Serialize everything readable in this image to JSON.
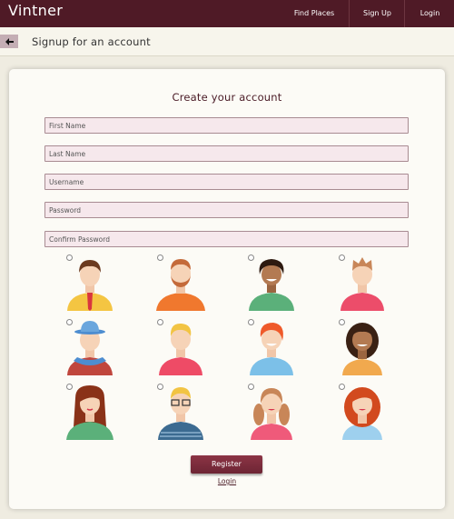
{
  "header": {
    "brand": "Vintner",
    "nav": [
      "Find Places",
      "Sign Up",
      "Login"
    ]
  },
  "subheader": {
    "title": "Signup for an account",
    "back_icon": "arrow-left-icon"
  },
  "form": {
    "title": "Create your account",
    "fields": {
      "first_name": "First Name",
      "last_name": "Last Name",
      "username": "Username",
      "password": "Password",
      "confirm_password": "Confirm Password"
    },
    "avatars": [
      "avatar-man-brown-hair-tie",
      "avatar-man-beard-orange-shirt",
      "avatar-man-curly-hair",
      "avatar-boy-spiky-hair",
      "avatar-man-blue-hat-scarf",
      "avatar-blond-boy",
      "avatar-redhead-boy",
      "avatar-woman-curly-dark",
      "avatar-woman-long-brown-hair",
      "avatar-man-glasses",
      "avatar-girl-pigtails",
      "avatar-woman-red-curly"
    ],
    "register_label": "Register",
    "login_label": "Login"
  },
  "colors": {
    "header_bg": "#4f1a26",
    "page_bg": "#efece1",
    "card_bg": "#fcfbf6",
    "field_bg": "#f6e8ec",
    "button": "#7b2c3c"
  }
}
